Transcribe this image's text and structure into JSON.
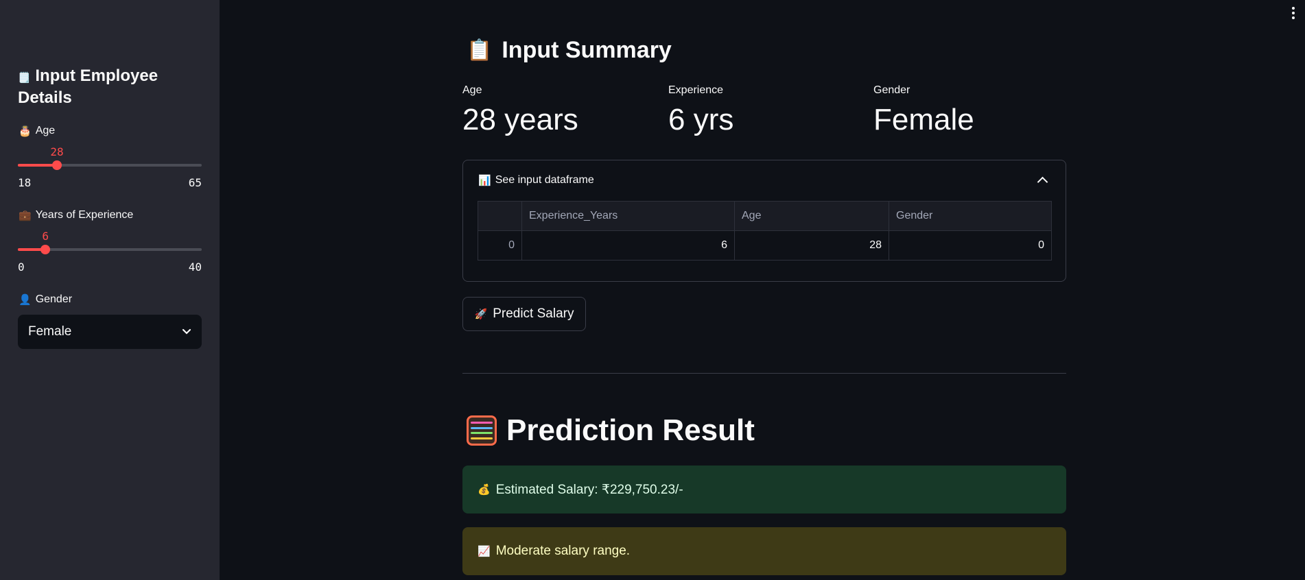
{
  "sidebar": {
    "title_icon": "🗒️",
    "title": "Input Employee Details",
    "age": {
      "icon": "🎂",
      "label": "Age",
      "value": 28,
      "min": 18,
      "max": 65
    },
    "experience": {
      "icon": "💼",
      "label": "Years of Experience",
      "value": 6,
      "min": 0,
      "max": 40
    },
    "gender": {
      "icon": "👤",
      "label": "Gender",
      "selected": "Female"
    }
  },
  "main": {
    "summary_icon": "📋",
    "summary_title": "Input Summary",
    "metrics": [
      {
        "label": "Age",
        "value": "28 years"
      },
      {
        "label": "Experience",
        "value": "6 yrs"
      },
      {
        "label": "Gender",
        "value": "Female"
      }
    ],
    "expander": {
      "icon": "📊",
      "label": "See input dataframe",
      "columns": [
        "",
        "Experience_Years",
        "Age",
        "Gender"
      ],
      "rows": [
        [
          "0",
          "6",
          "28",
          "0"
        ]
      ]
    },
    "predict_button": {
      "icon": "🚀",
      "label": "Predict Salary"
    },
    "result_title": "Prediction Result",
    "success": {
      "icon": "💰",
      "text": "Estimated Salary: ₹229,750.23/-"
    },
    "warning": {
      "icon": "📈",
      "text": "Moderate salary range."
    }
  },
  "colors": {
    "accent": "#ff4b4b",
    "background": "#0e1117",
    "sidebar": "#262730",
    "success_bg": "#173928",
    "warning_bg": "#3e3a16"
  }
}
